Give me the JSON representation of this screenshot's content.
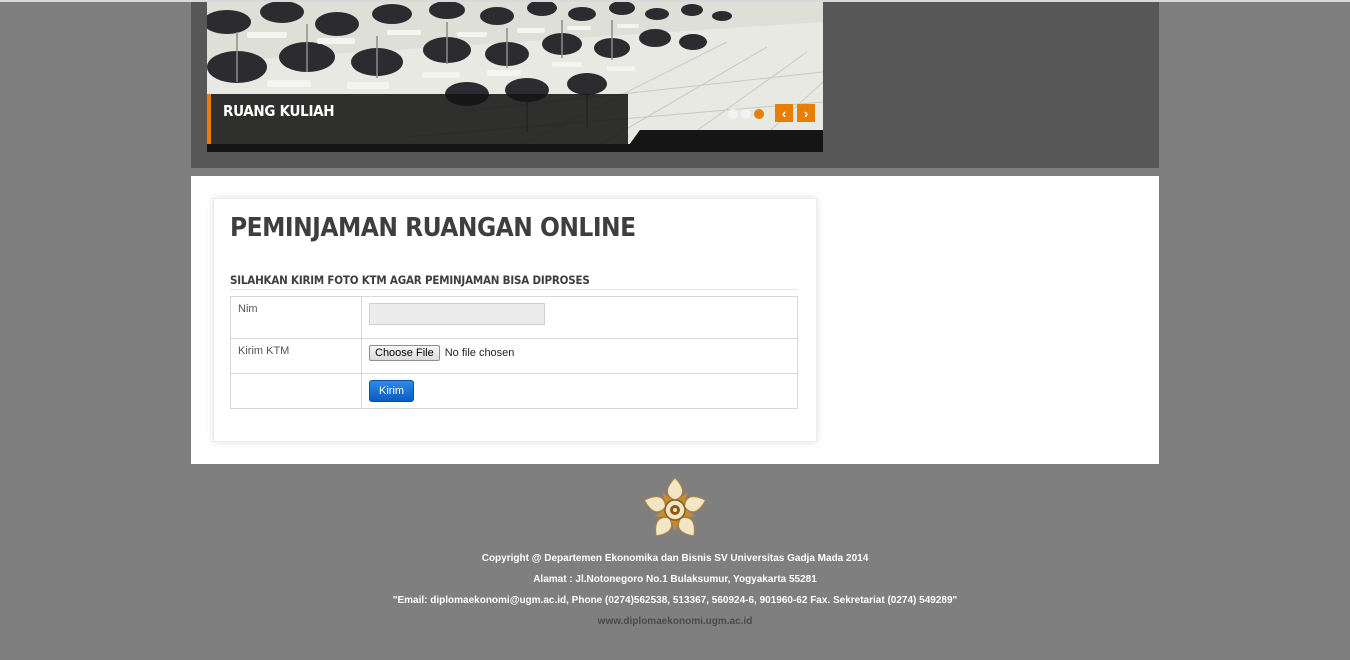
{
  "slider": {
    "caption": "RUANG KULIAH",
    "prev_symbol": "‹",
    "next_symbol": "›",
    "active_slide": 3,
    "slide_count": 3,
    "accent_color": "#e87e04"
  },
  "form": {
    "title": "PEMINJAMAN RUANGAN ONLINE",
    "subtitle": "SILAHKAN KIRIM FOTO KTM AGAR PEMINJAMAN BISA DIPROSES",
    "nim_label": "Nim",
    "nim_value": "",
    "ktm_label": "Kirim KTM",
    "choose_file_label": "Choose File",
    "no_file_text": "No file chosen",
    "submit_label": "Kirim"
  },
  "footer": {
    "copyright": "Copyright @ Departemen Ekonomika dan Bisnis SV Universitas Gadja Mada 2014",
    "address": "Alamat : Jl.Notonegoro No.1 Bulaksumur, Yogyakarta 55281",
    "contact": "\"Email: diplomaekonomi@ugm.ac.id, Phone (0274)562538, 513367, 560924-6, 901960-62 Fax. Sekretariat (0274) 549289\"",
    "website": "www.diplomaekonomi.ugm.ac.id"
  }
}
